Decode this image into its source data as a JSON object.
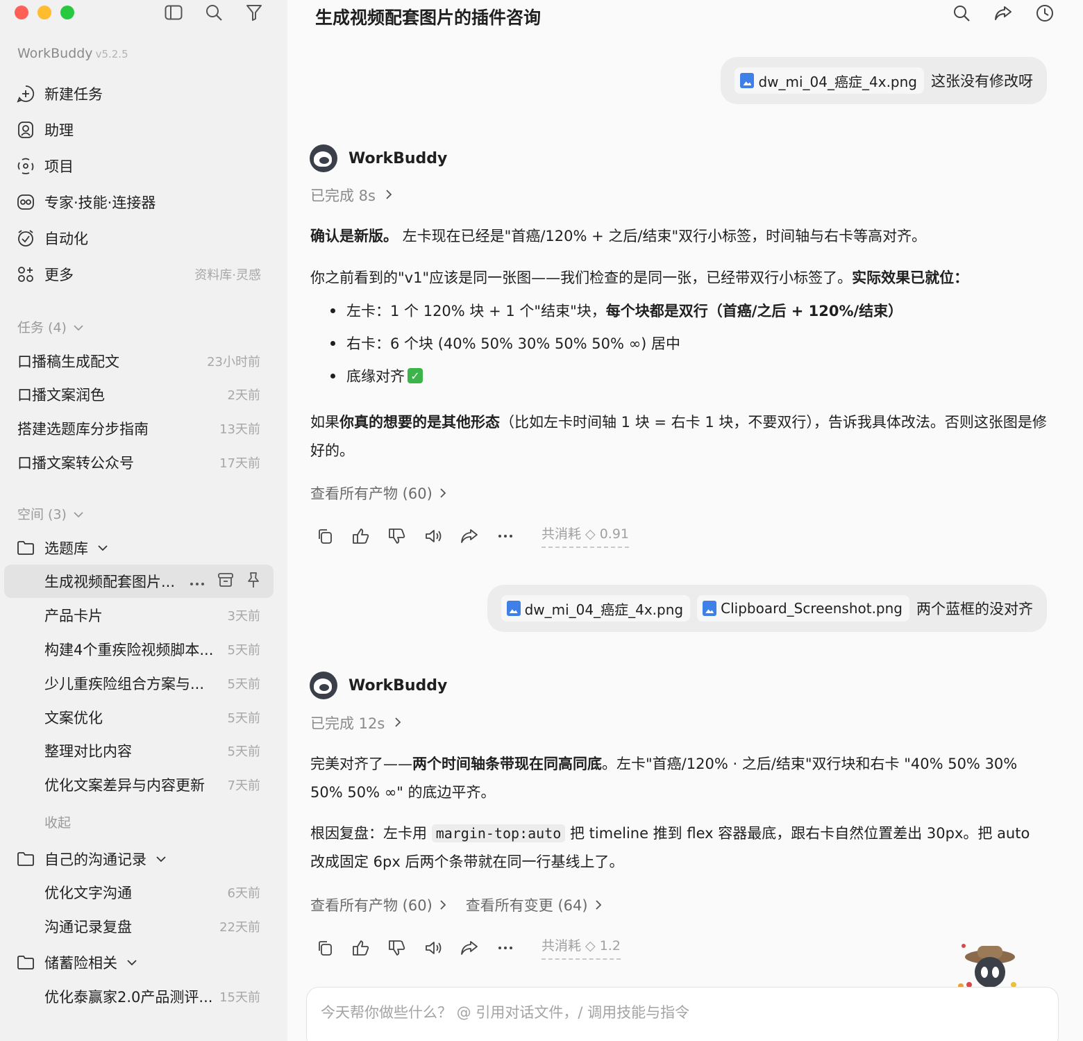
{
  "sidebar": {
    "app_name": "WorkBuddy",
    "version": "v5.2.5",
    "nav": [
      {
        "label": "新建任务",
        "icon": "plus-circle-icon",
        "hint": ""
      },
      {
        "label": "助理",
        "icon": "assistant-icon",
        "hint": ""
      },
      {
        "label": "项目",
        "icon": "project-icon",
        "hint": ""
      },
      {
        "label": "专家·技能·连接器",
        "icon": "expert-icon",
        "hint": ""
      },
      {
        "label": "自动化",
        "icon": "automation-icon",
        "hint": ""
      },
      {
        "label": "更多",
        "icon": "more-grid-icon",
        "hint": "资料库·灵感"
      }
    ],
    "tasks_header": "任务 (4)",
    "tasks": [
      {
        "label": "口播稿生成配文",
        "time": "23小时前"
      },
      {
        "label": "口播文案润色",
        "time": "2天前"
      },
      {
        "label": "搭建选题库分步指南",
        "time": "13天前"
      },
      {
        "label": "口播文案转公众号",
        "time": "17天前"
      }
    ],
    "spaces_header": "空间 (3)",
    "spaces": [
      {
        "label": "选题库",
        "items": [
          {
            "label": "生成视频配套图片...",
            "time": "",
            "active": true
          },
          {
            "label": "产品卡片",
            "time": "3天前"
          },
          {
            "label": "构建4个重疾险视频脚本...",
            "time": "5天前"
          },
          {
            "label": "少儿重疾险组合方案与...",
            "time": "5天前"
          },
          {
            "label": "文案优化",
            "time": "5天前"
          },
          {
            "label": "整理对比内容",
            "time": "5天前"
          },
          {
            "label": "优化文案差异与内容更新",
            "time": "7天前"
          }
        ],
        "collapse_label": "收起"
      },
      {
        "label": "自己的沟通记录",
        "items": [
          {
            "label": "优化文字沟通",
            "time": "6天前"
          },
          {
            "label": "沟通记录复盘",
            "time": "22天前"
          }
        ]
      },
      {
        "label": "储蓄险相关",
        "items": [
          {
            "label": "优化泰赢家2.0产品测评...",
            "time": "15天前"
          }
        ]
      }
    ]
  },
  "main": {
    "title": "生成视频配套图片的插件咨询",
    "bot_name": "WorkBuddy",
    "msg1_user": {
      "files": [
        "dw_mi_04_癌症_4x.png"
      ],
      "text": "这张没有修改呀"
    },
    "msg1_bot": {
      "status": "已完成 8s",
      "p1_bold": "确认是新版。",
      "p1_rest": " 左卡现在已经是\"首癌/120% + 之后/结束\"双行小标签，时间轴与右卡等高对齐。",
      "p2_text": "你之前看到的\"v1\"应该是同一张图——我们检查的是同一张，已经带双行小标签了。",
      "p2_bold": "实际效果已就位：",
      "b1_text": "左卡：1 个 120% 块 + 1 个\"结束\"块，",
      "b1_bold": "每个块都是双行（首癌/之后 + 120%/结束）",
      "b2_text": "右卡：6 个块 (40% 50% 30% 50% 50% ∞) 居中",
      "b3_text": "底缘对齐",
      "p3_pre": "如果",
      "p3_bold": "你真的想要的是其他形态",
      "p3_rest": "（比如左卡时间轴 1 块 = 右卡 1 块，不要双行），告诉我具体改法。否则这张图是修好的。",
      "link_artifacts": "查看所有产物 (60)",
      "cost": "共消耗 ◇ 0.91"
    },
    "msg2_user": {
      "files": [
        "dw_mi_04_癌症_4x.png",
        "Clipboard_Screenshot.png"
      ],
      "text": "两个蓝框的没对齐"
    },
    "msg2_bot": {
      "status": "已完成 12s",
      "p1_pre": "完美对齐了——",
      "p1_bold": "两个时间轴条带现在同高同底",
      "p1_rest": "。左卡\"首癌/120% · 之后/结束\"双行块和右卡 \"40% 50% 30% 50% 50% ∞\" 的底边平齐。",
      "p2_pre": "根因复盘：左卡用 ",
      "p2_code": "margin-top:auto",
      "p2_rest": " 把 timeline 推到 flex 容器最底，跟右卡自然位置差出 30px。把 auto 改成固定 6px 后两个条带就在同一行基线上了。",
      "link_artifacts": "查看所有产物 (60)",
      "link_changes": "查看所有变更 (64)",
      "cost": "共消耗 ◇ 1.2"
    },
    "input_placeholder": "今天帮你做些什么？ @ 引用对话文件，/ 调用技能与指令"
  }
}
